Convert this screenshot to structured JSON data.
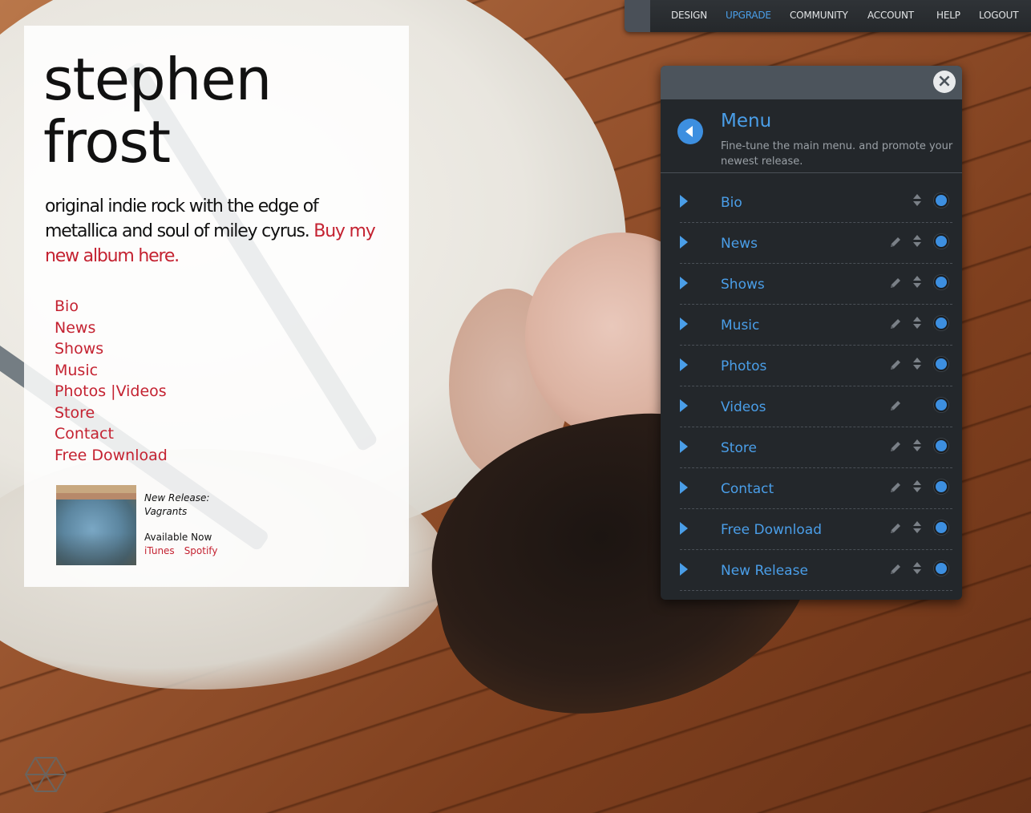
{
  "topnav": {
    "items": [
      "DESIGN",
      "UPGRADE",
      "COMMUNITY",
      "ACCOUNT",
      "HELP",
      "LOGOUT"
    ],
    "active": "UPGRADE"
  },
  "site": {
    "title_line1": "stephen",
    "title_line2": "frost",
    "tagline": "original indie rock with the edge of metallica and soul of miley cyrus.",
    "buy_link": "Buy my new album here.",
    "nav": [
      "Bio",
      "News",
      "Shows",
      "Music",
      "Photos",
      "Videos",
      "Store",
      "Contact",
      "Free Download"
    ],
    "nav_separator": "|",
    "release": {
      "heading": "New Release:",
      "album": "Vagrants",
      "availability": "Available Now",
      "links": [
        "iTunes",
        "Spotify"
      ]
    }
  },
  "editor": {
    "title": "Menu",
    "description": "Fine-tune the main menu. and promote your newest release.",
    "items": [
      "Bio",
      "News",
      "Shows",
      "Music",
      "Photos",
      "Videos",
      "Store",
      "Contact",
      "Free Download",
      "New Release"
    ]
  },
  "colors": {
    "accent": "#4a9ee8",
    "site_link": "#c42231",
    "editor_bg": "#23272b"
  },
  "icons": {
    "close": "close-icon",
    "back": "arrow-left-icon",
    "edit": "pencil-icon",
    "sort": "sort-icon",
    "toggle": "toggle-icon",
    "logo": "hexagon-logo-icon"
  }
}
